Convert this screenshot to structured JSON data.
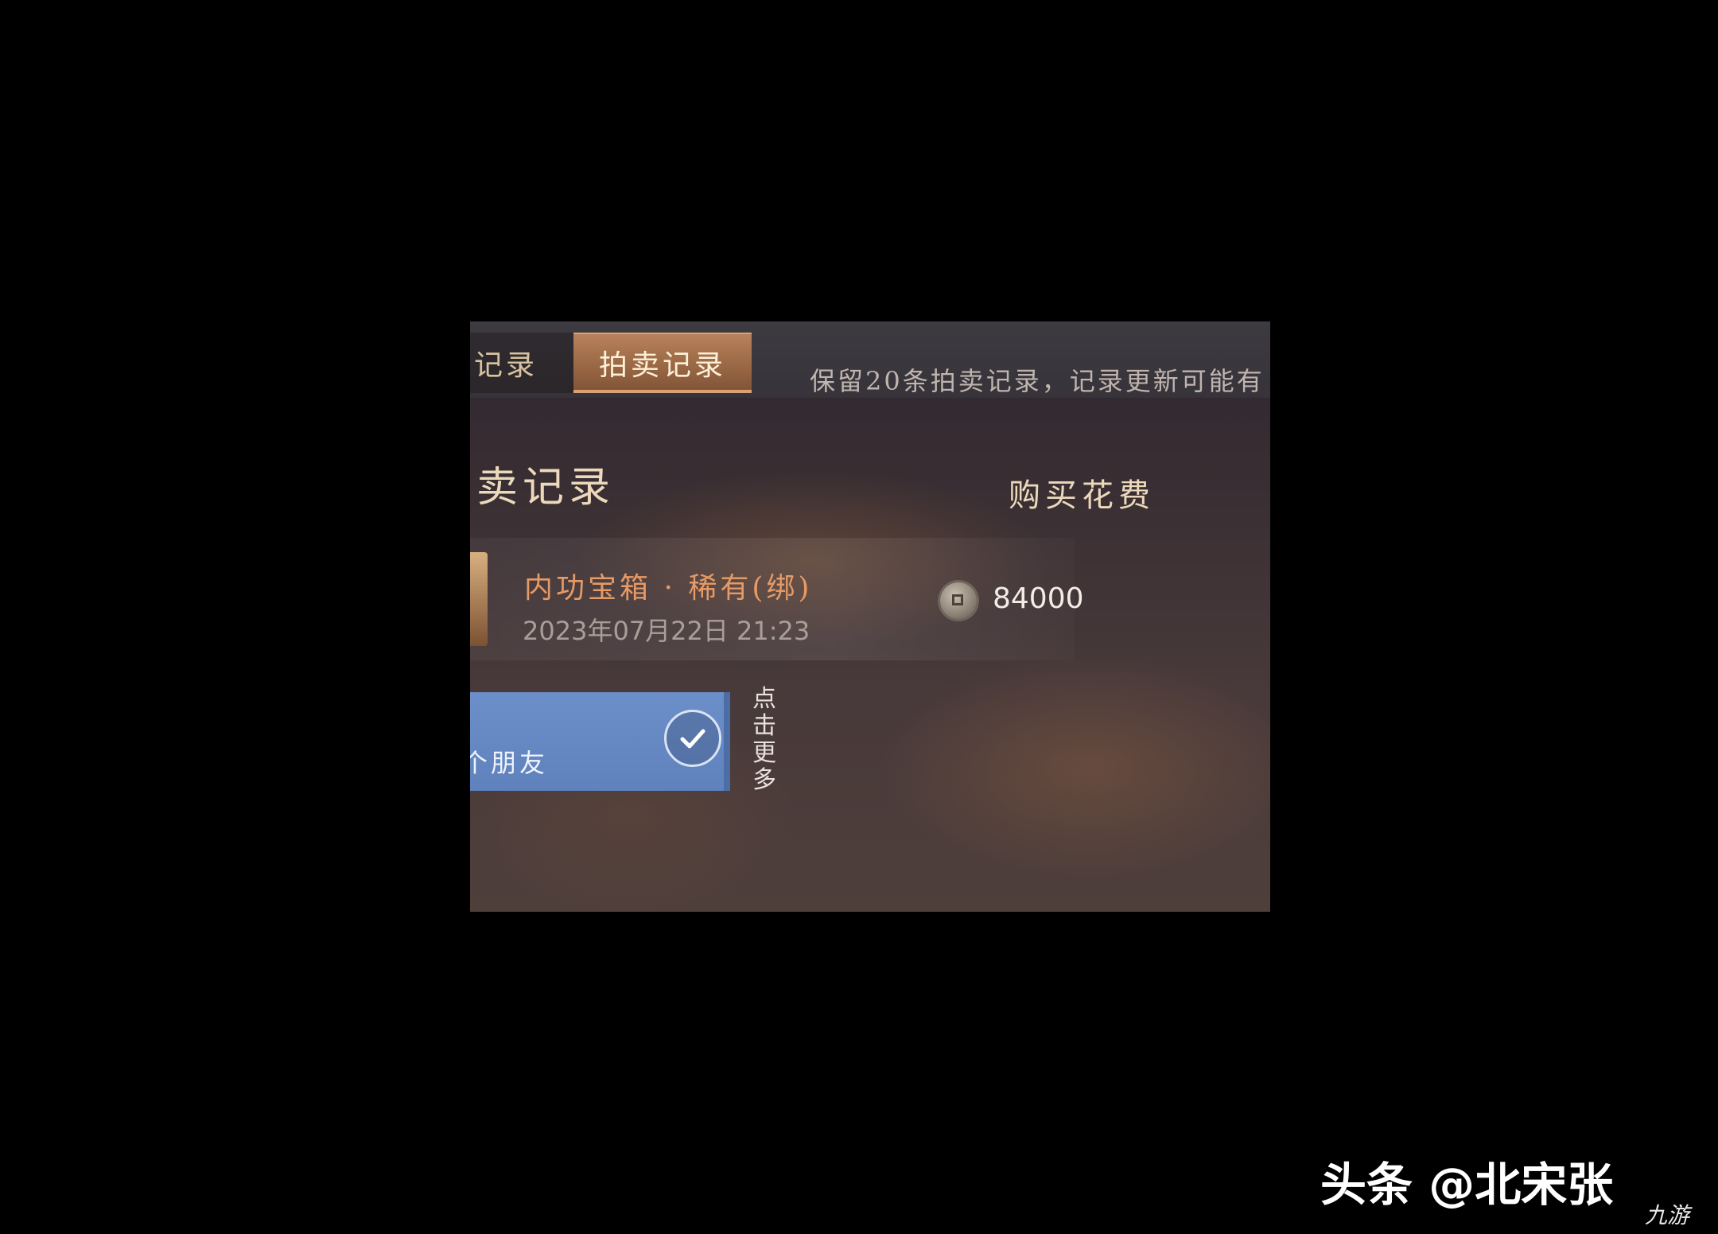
{
  "tabs": [
    {
      "label": "易记录",
      "visible_label": "记录",
      "active": false
    },
    {
      "label": "拍卖记录",
      "active": true
    }
  ],
  "tab_note": "保留20条拍卖记录，记录更新可能有",
  "section_title": "卖记录",
  "column_header": "购买花费",
  "records": [
    {
      "name": "内功宝箱 · 稀有(绑)",
      "time": "2023年07月22日 21:23",
      "cost": "84000",
      "currency_icon": "coin-icon"
    }
  ],
  "friend_banner": {
    "text": "个朋友",
    "check_icon": "check-icon"
  },
  "more_link": "点击更多",
  "watermarks": {
    "toutiao": "头条 @北宋张",
    "jiuyou": "九游"
  },
  "colors": {
    "tab_active": "#9a6845",
    "item_name": "#e69a66",
    "banner_blue": "#6c8fc9"
  }
}
